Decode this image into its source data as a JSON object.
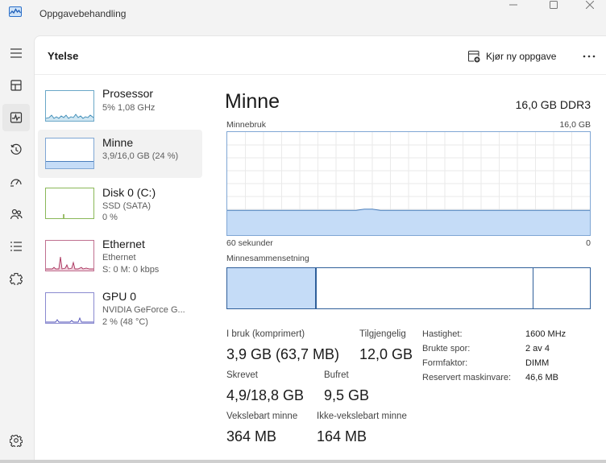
{
  "window": {
    "title": "Oppgavebehandling",
    "minimize_icon": "minimize-icon",
    "maximize_icon": "maximize-icon",
    "close_icon": "close-icon"
  },
  "nav": {
    "items": [
      {
        "icon": "hamburger-menu-icon"
      },
      {
        "icon": "processes-icon"
      },
      {
        "icon": "performance-icon",
        "active": true
      },
      {
        "icon": "app-history-icon"
      },
      {
        "icon": "startup-apps-icon"
      },
      {
        "icon": "users-icon"
      },
      {
        "icon": "details-icon"
      },
      {
        "icon": "services-icon"
      },
      {
        "icon": "settings-icon"
      }
    ]
  },
  "header": {
    "title": "Ytelse",
    "run_task_label": "Kjør ny oppgave",
    "run_task_icon": "run-task-icon",
    "more_icon": "more-options-icon"
  },
  "devices": [
    {
      "name": "Prosessor",
      "sub1": "5% 1,08 GHz",
      "sub2": ""
    },
    {
      "name": "Minne",
      "sub1": "3,9/16,0 GB (24 %)",
      "sub2": "",
      "selected": true
    },
    {
      "name": "Disk 0 (C:)",
      "sub1": "SSD (SATA)",
      "sub2": "0 %"
    },
    {
      "name": "Ethernet",
      "sub1": "Ethernet",
      "sub2": "S: 0 M: 0 kbps"
    },
    {
      "name": "GPU 0",
      "sub1": "NVIDIA GeForce G...",
      "sub2": "2 % (48 °C)"
    }
  ],
  "memory": {
    "title": "Minne",
    "spec": "16,0 GB DDR3",
    "usage_label": "Minnebruk",
    "usage_max": "16,0 GB",
    "time_left": "60 sekunder",
    "time_right": "0",
    "usage_fraction": 0.24,
    "composition_label": "Minnesammensetning",
    "composition": {
      "in_use_fraction": 0.245,
      "modified_fraction": 0.002,
      "standby_fraction": 0.598,
      "free_fraction": 0.155
    },
    "colors": {
      "graph_fill": "#c5dcf7",
      "graph_line": "#4a7ebc",
      "graph_border": "#7fa6d4",
      "grid": "#eaeaea"
    },
    "stats": {
      "in_use_label": "I bruk (komprimert)",
      "in_use_value": "3,9 GB (63,7 MB)",
      "available_label": "Tilgjengelig",
      "available_value": "12,0 GB",
      "committed_label": "Skrevet",
      "committed_value": "4,9/18,8 GB",
      "cached_label": "Bufret",
      "cached_value": "9,5 GB",
      "paged_label": "Vekslebart minne",
      "paged_value": "364 MB",
      "nonpaged_label": "Ikke-vekslebart minne",
      "nonpaged_value": "164 MB"
    },
    "details": [
      {
        "label": "Hastighet:",
        "value": "1600 MHz"
      },
      {
        "label": "Brukte spor:",
        "value": "2 av 4"
      },
      {
        "label": "Formfaktor:",
        "value": "DIMM"
      },
      {
        "label": "Reservert maskinvare:",
        "value": "46,6 MB"
      }
    ]
  }
}
